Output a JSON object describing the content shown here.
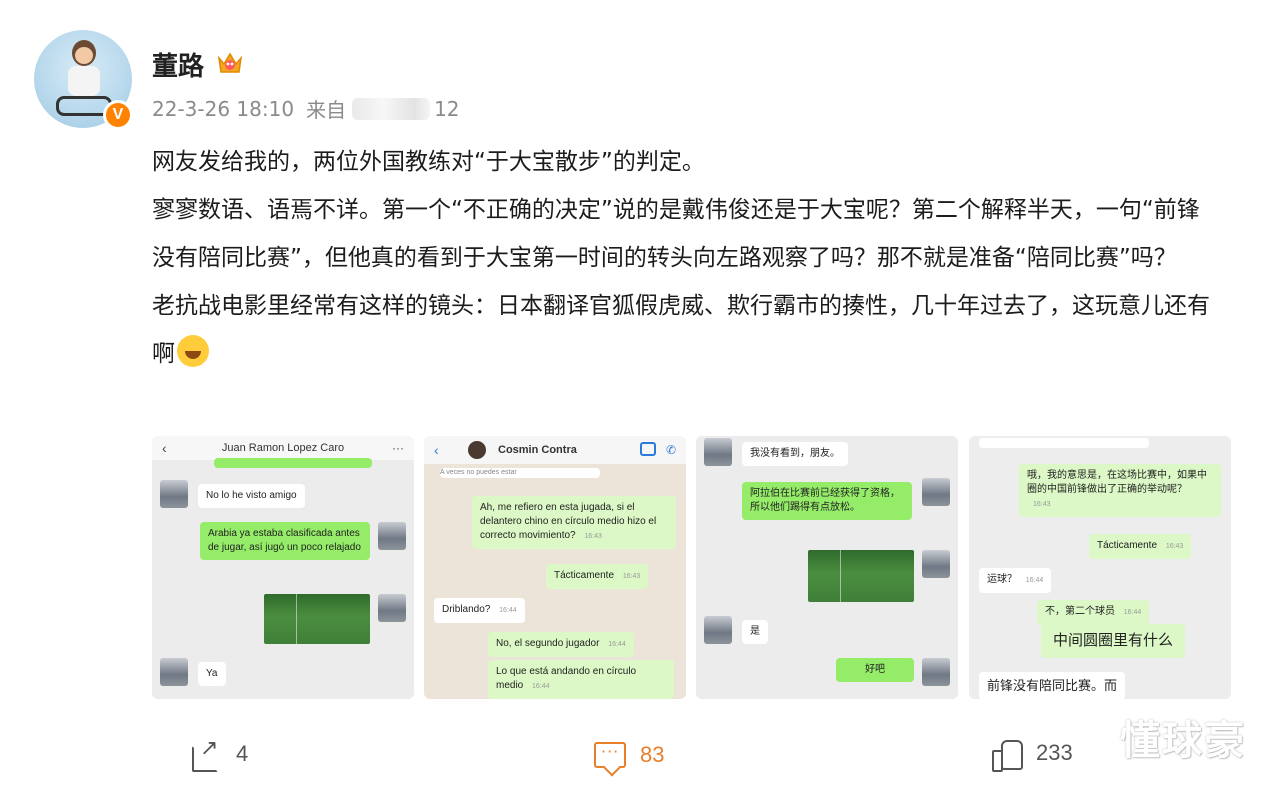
{
  "author": {
    "name": "董路",
    "verified_badge": "V",
    "badge_color": "#ff8200"
  },
  "meta": {
    "date": "22-3-26 18:10",
    "source_prefix": "来自",
    "source_suffix": "12"
  },
  "post": {
    "paragraphs": [
      "网友发给我的，两位外国教练对“于大宝散步”的判定。",
      "寥寥数语、语焉不详。第一个“不正确的决定”说的是戴伟俊还是于大宝呢？第二个解释半天，一句“前锋没有陪同比赛”，但他真的看到于大宝第一时间的转头向左路观察了吗？那不就是准备“陪同比赛”吗？",
      "老抗战电影里经常有这样的镜头：日本翻译官狐假虎威、欺行霸市的揍性，几十年过去了，这玩意儿还有啊"
    ],
    "emoji": "laugh-cry-icon"
  },
  "images": {
    "shot1": {
      "title": "Juan Ramon Lopez Caro",
      "msg1": "No lo he visto amigo",
      "msg2": "Arabia ya estaba clasificada antes de jugar, así jugó un poco relajado",
      "msg3": "Ya"
    },
    "shot2": {
      "title": "Cosmin Contra",
      "msg0": "A veces no puedes estar",
      "msg1": "Ah, me refiero en esta jugada, si el delantero chino en círculo medio hizo el correcto movimiento?",
      "msg1_time": "16:43",
      "msg2": "Tácticamente",
      "msg2_time": "16:43",
      "msg3": "Driblando?",
      "msg3_time": "16:44",
      "msg4": "No, el segundo jugador",
      "msg4_time": "16:44",
      "msg5": "Lo que está andando en círculo medio",
      "msg5_time": "16:44"
    },
    "shot3": {
      "msg1": "我没有看到，朋友。",
      "msg2": "阿拉伯在比赛前已经获得了资格，所以他们踢得有点放松。",
      "msg3": "是",
      "msg4": "好吧"
    },
    "shot4": {
      "msg1": "哦，我的意思是，在这场比赛中，如果中圈的中国前锋做出了正确的举动呢？",
      "msg1_time": "16:43",
      "msg2": "Tácticamente",
      "msg2_time": "16:43",
      "msg3": "运球？",
      "msg3_time": "16:44",
      "msg4": "不，第二个球员",
      "msg4_time": "16:44",
      "msg5": "中间圆圈里有什么",
      "msg6": "前锋没有陪同比赛。而"
    }
  },
  "actions": {
    "share_count": "4",
    "comment_count": "83",
    "like_count": "233",
    "comment_color": "#e8802b"
  },
  "watermark": "懂球豪"
}
